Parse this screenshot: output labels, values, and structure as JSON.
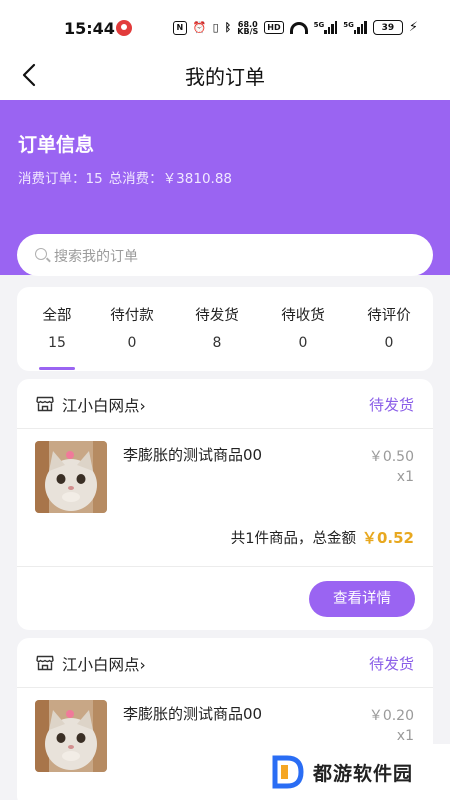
{
  "status_bar": {
    "time": "15:44",
    "network_speed_top": "68.0",
    "network_speed_bottom": "KB/S",
    "hd_label": "HD",
    "signal_label_1": "5G",
    "signal_label_2": "5G",
    "battery": "39"
  },
  "header": {
    "title": "我的订单"
  },
  "summary": {
    "title": "订单信息",
    "orders_label": "消费订单：",
    "orders_count": "15",
    "spend_label": "总消费：",
    "spend_value": "￥3810.88"
  },
  "search": {
    "placeholder": "搜索我的订单"
  },
  "tabs": [
    {
      "label": "全部",
      "count": "15",
      "active": true
    },
    {
      "label": "待付款",
      "count": "0",
      "active": false
    },
    {
      "label": "待发货",
      "count": "8",
      "active": false
    },
    {
      "label": "待收货",
      "count": "0",
      "active": false
    },
    {
      "label": "待评价",
      "count": "0",
      "active": false
    }
  ],
  "orders": [
    {
      "shop": "江小白网点",
      "status": "待发货",
      "product_name": "李膨胀的测试商品00",
      "unit_price": "￥0.50",
      "quantity": "x1",
      "total_label": "共1件商品，总金额",
      "total_amount": "￥0.52",
      "detail_button": "查看详情"
    },
    {
      "shop": "江小白网点",
      "status": "待发货",
      "product_name": "李膨胀的测试商品00",
      "unit_price": "￥0.20",
      "quantity": "x1"
    }
  ],
  "watermark": {
    "text": "都游软件园"
  },
  "colors": {
    "accent": "#9a64f2",
    "status_text": "#8a5ee8",
    "amount": "#e8a81f",
    "background": "#f3f3f6"
  }
}
